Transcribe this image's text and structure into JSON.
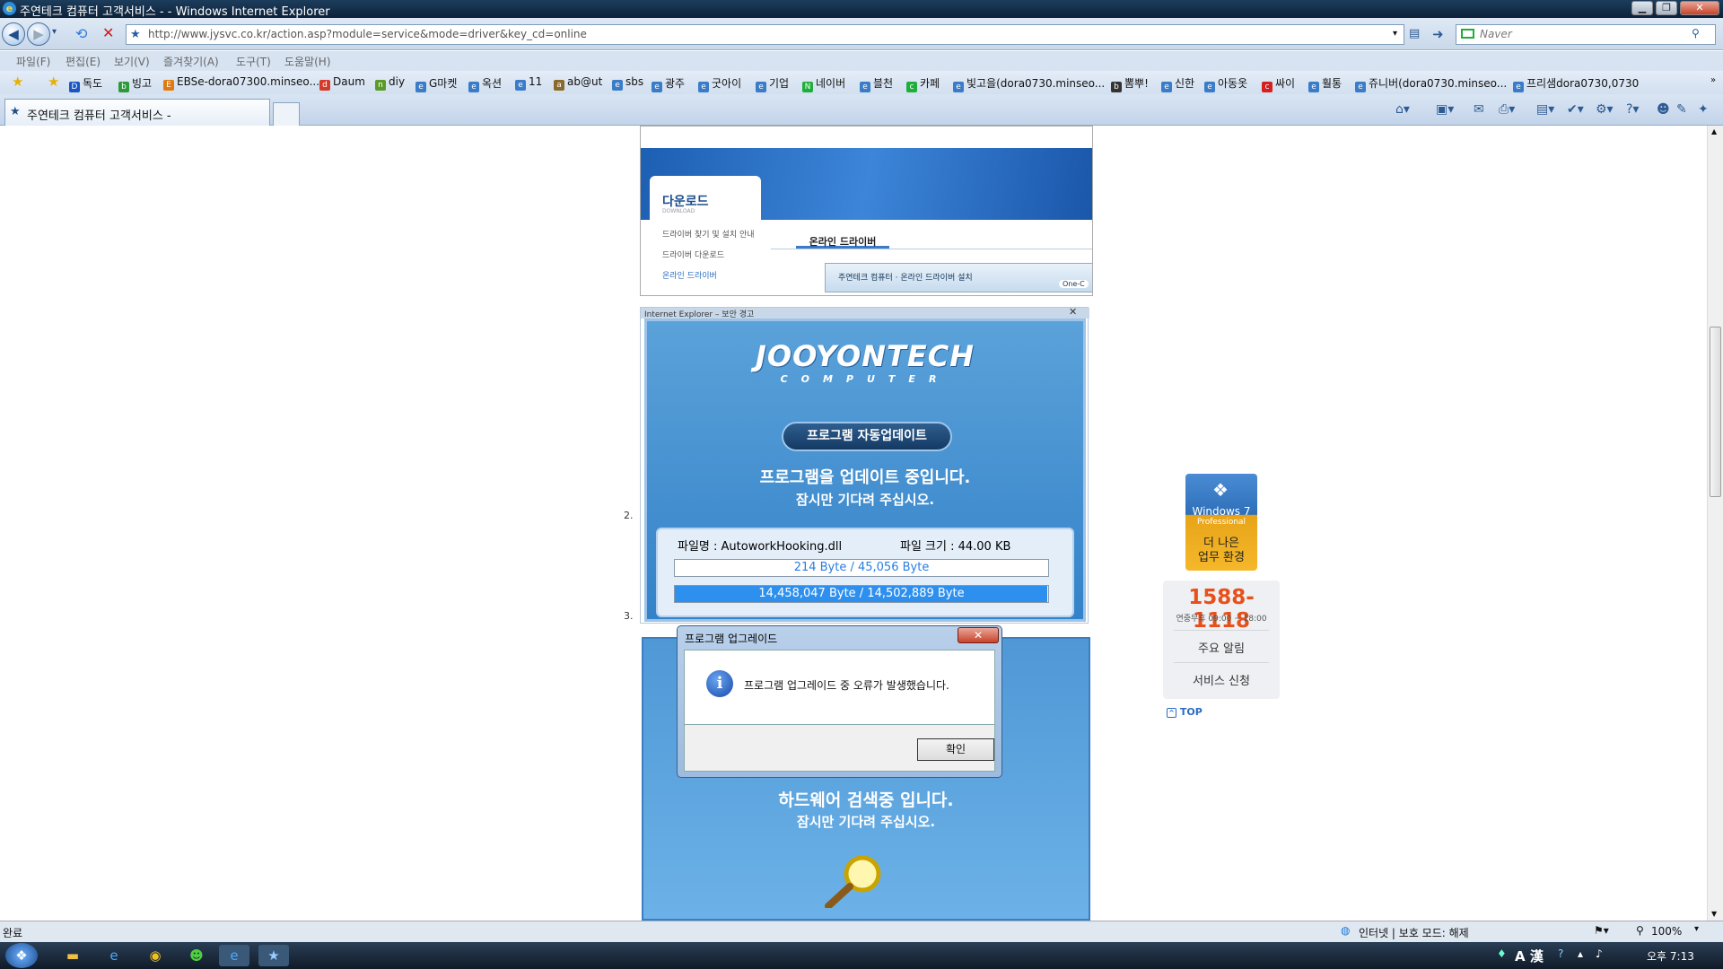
{
  "window": {
    "title": "주연테크 컴퓨터 고객서비스 - - Windows Internet Explorer",
    "btn_min": "▁",
    "btn_max": "❐",
    "btn_close": "✕"
  },
  "address": {
    "url": "http://www.jysvc.co.kr/action.asp?module=service&mode=driver&key_cd=online",
    "search_placeholder": "Naver"
  },
  "menu": [
    "파일(F)",
    "편집(E)",
    "보기(V)",
    "즐겨찾기(A)",
    "도구(T)",
    "도움말(H)"
  ],
  "favorites": [
    {
      "label": "독도",
      "color": "#1a55c4",
      "icon": "D"
    },
    {
      "label": "빙고",
      "color": "#2c9a3a",
      "icon": "b"
    },
    {
      "label": "EBSe-dora07300.minseo...",
      "color": "#e07a10",
      "icon": "E"
    },
    {
      "label": "Daum",
      "color": "#d43a2a",
      "icon": "d"
    },
    {
      "label": "diy",
      "color": "#5a9a2a",
      "icon": "n"
    },
    {
      "label": "G마켓",
      "color": "#3a7cc8",
      "icon": "e"
    },
    {
      "label": "옥션",
      "color": "#3a7cc8",
      "icon": "e"
    },
    {
      "label": "11",
      "color": "#3a7cc8",
      "icon": "e"
    },
    {
      "label": "ab@ut",
      "color": "#8a6a2a",
      "icon": "a"
    },
    {
      "label": "sbs",
      "color": "#3a7cc8",
      "icon": "e"
    },
    {
      "label": "광주",
      "color": "#3a7cc8",
      "icon": "e"
    },
    {
      "label": "굿아이",
      "color": "#3a7cc8",
      "icon": "e"
    },
    {
      "label": "기업",
      "color": "#3a7cc8",
      "icon": "e"
    },
    {
      "label": "네이버",
      "color": "#1fae3a",
      "icon": "N"
    },
    {
      "label": "블천",
      "color": "#3a7cc8",
      "icon": "e"
    },
    {
      "label": "카페",
      "color": "#1fae3a",
      "icon": "c"
    },
    {
      "label": "빛고을(dora0730.minseo...",
      "color": "#3a7cc8",
      "icon": "e"
    },
    {
      "label": "뽐뿌!",
      "color": "#333333",
      "icon": "뽐"
    },
    {
      "label": "신한",
      "color": "#3a7cc8",
      "icon": "e"
    },
    {
      "label": "아동옷",
      "color": "#3a7cc8",
      "icon": "e"
    },
    {
      "label": "싸이",
      "color": "#d42020",
      "icon": "c"
    },
    {
      "label": "훨통",
      "color": "#3a7cc8",
      "icon": "e"
    },
    {
      "label": "쥬니버(dora0730.minseo...",
      "color": "#3a7cc8",
      "icon": "e"
    },
    {
      "label": "프리샘dora0730,0730",
      "color": "#3a7cc8",
      "icon": "e"
    }
  ],
  "tab": {
    "title": "주연테크 컴퓨터 고객서비스 -"
  },
  "page": {
    "download_heading": "다운로드",
    "download_sub": "DOWNLOAD",
    "download_items": [
      "드라이버 찾기 및 설치 안내",
      "드라이버 다운로드",
      "온라인 드라이버"
    ],
    "online_tab": "온라인 드라이버",
    "strip_text": "주연테크 컴퓨터 · 온라인 드라이버 설치",
    "strip_btn": "One-C",
    "updater_titlebar": "Internet Explorer – 보안 경고",
    "logo": "JOOYONTECH",
    "logo_sub": "COMPUTER",
    "pill": "프로그램 자동업데이트",
    "msg1": "프로그램을 업데이트 중입니다.",
    "msg2": "잠시만 기다려 주십시오.",
    "file_name": "파일명 : AutoworkHooking.dll",
    "file_size": "파일 크기 : 44.00 KB",
    "bar1_text": "214 Byte / 45,056 Byte",
    "bar2_text": "14,458,047 Byte / 14,502,889 Byte",
    "bar2_progress": 0.997,
    "num2": "2.",
    "num3": "3.",
    "scan1": "하드웨어 검색중 입니다.",
    "scan2": "잠시만 기다려 주십시오."
  },
  "dialog": {
    "title": "프로그램 업그레이드",
    "message": "프로그램 업그레이드 중 오류가 발생했습니다.",
    "ok": "확인",
    "close": "✕"
  },
  "sidebar": {
    "win_title": "Windows 7",
    "win_edition": "Professional",
    "win_slogan1": "더 나은",
    "win_slogan2": "업무 환경",
    "phone": "1588-1118",
    "hours": "연중무휴 09:00 ~ 18:00",
    "notice": "주요 알림",
    "service": "서비스 신청",
    "top": "TOP"
  },
  "status": {
    "left": "완료",
    "zone": "인터넷 | 보호 모드: 해제",
    "zoom": "100%"
  },
  "taskbar": {
    "time": "오후 7:13",
    "ime": "A 漢"
  },
  "colors": {
    "accent": "#2e90ee",
    "phone": "#e8501a"
  }
}
